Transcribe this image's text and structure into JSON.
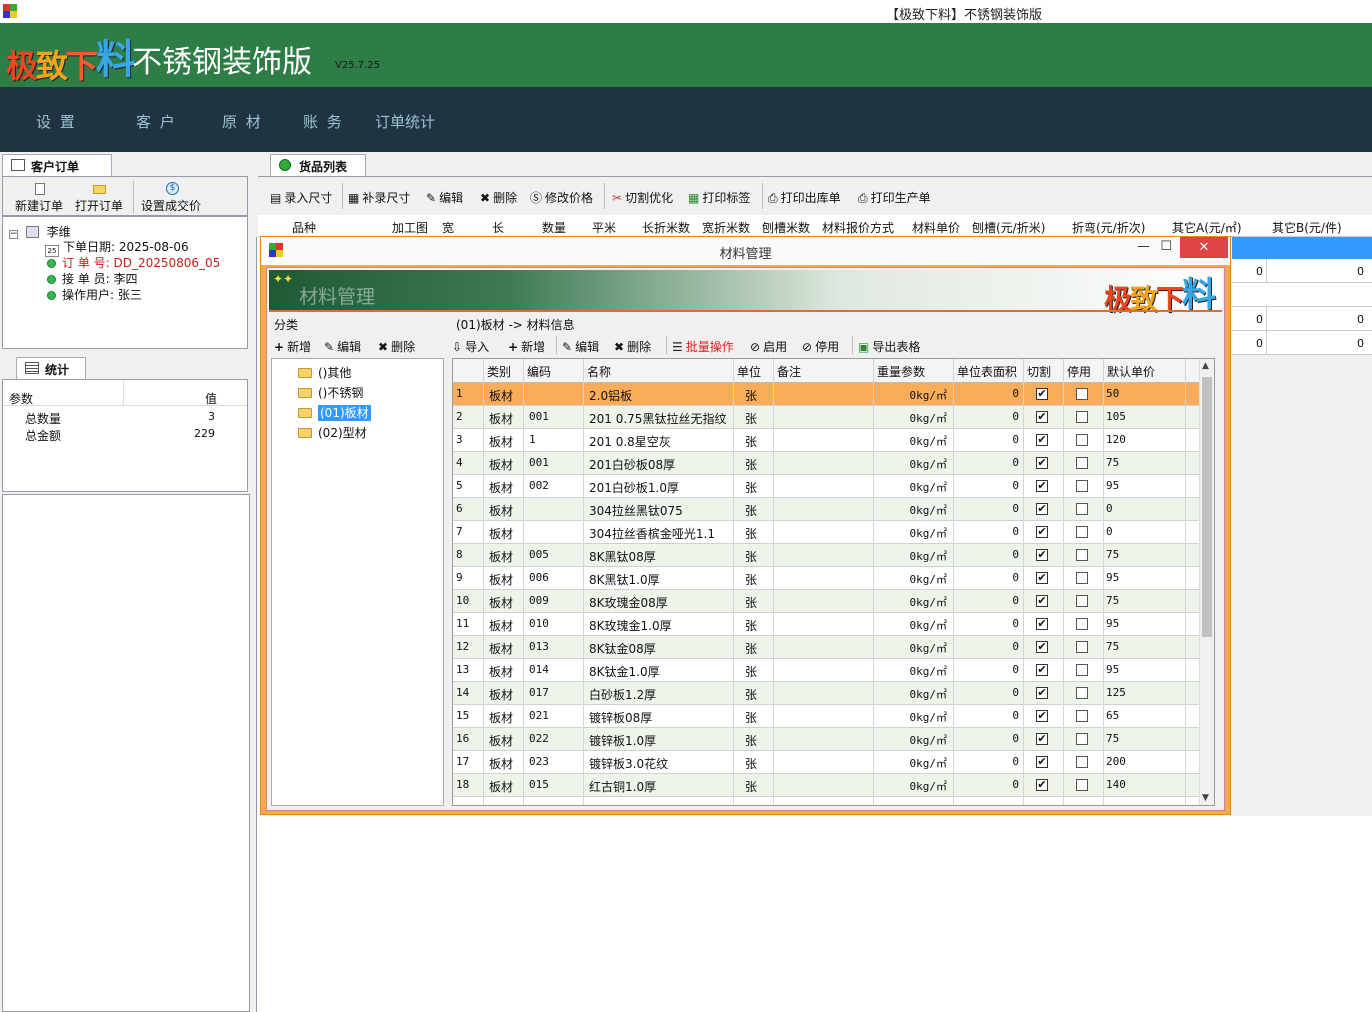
{
  "window": {
    "title": "【极致下料】不锈钢装饰版"
  },
  "banner": {
    "logo": [
      "极",
      "致",
      "下",
      "料"
    ],
    "product": "不锈钢装饰版",
    "version": "V25.7.25"
  },
  "menu": [
    "设 置",
    "客 户",
    "原 材",
    "账 务",
    "订单统计"
  ],
  "orders_panel": {
    "tab": "客户订单",
    "buttons": [
      "新建订单",
      "打开订单",
      "设置成交价"
    ],
    "tree": {
      "root": "李维",
      "date_label": "下单日期: 2025-08-06",
      "order_no_label": "订 单 号: ",
      "order_no": "DD_20250806_05",
      "receiver": "接 单 员: 李四",
      "operator": "操作用户: 张三",
      "calendar_day": "25"
    }
  },
  "stats_panel": {
    "tab": "统计",
    "headers": [
      "参数",
      "值"
    ],
    "rows": [
      {
        "k": "总数量",
        "v": "3"
      },
      {
        "k": "总金额",
        "v": "229"
      }
    ]
  },
  "goods_panel": {
    "tab": "货品列表",
    "toolbar": [
      "录入尺寸",
      "补录尺寸",
      "编辑",
      "删除",
      "修改价格",
      "切割优化",
      "打印标签",
      "打印出库单",
      "打印生产单"
    ],
    "columns": [
      "品种",
      "加工图",
      "宽",
      "长",
      "数量",
      "平米",
      "长折米数",
      "宽折米数",
      "刨槽米数",
      "材料报价方式",
      "材料单价",
      "刨槽(元/折米)",
      "折弯(元/折次)",
      "其它A(元/㎡)",
      "其它B(元/件)"
    ],
    "row_values": [
      [
        "0",
        "0"
      ],
      [
        "0",
        "0"
      ],
      [
        "0",
        "0"
      ]
    ]
  },
  "dialog": {
    "title": "材料管理",
    "controls": {
      "min": "—",
      "max": "☐",
      "close": "✕"
    },
    "watermark": "材料管理",
    "category": {
      "label": "分类",
      "buttons": [
        "新增",
        "编辑",
        "删除"
      ],
      "items": [
        "()其他",
        "()不锈钢",
        "(01)板材",
        "(02)型材"
      ]
    },
    "breadcrumb": "(01)板材 -> 材料信息",
    "toolbar": {
      "import": "导入",
      "add": "新增",
      "edit": "编辑",
      "delete": "删除",
      "batch": "批量操作",
      "enable": "启用",
      "disable": "停用",
      "export": "导出表格"
    },
    "columns": [
      "类别",
      "编码",
      "名称",
      "单位",
      "备注",
      "重量参数",
      "单位表面积",
      "切割",
      "停用",
      "默认单价"
    ],
    "rows": [
      {
        "n": "1",
        "cat": "板材",
        "code": "",
        "name": "2.0铝板",
        "unit": "张",
        "weight": "0kg/㎡",
        "area": "0",
        "price": "50"
      },
      {
        "n": "2",
        "cat": "板材",
        "code": "001",
        "name": "201 0.75黑钛拉丝无指纹",
        "unit": "张",
        "weight": "0kg/㎡",
        "area": "0",
        "price": "105"
      },
      {
        "n": "3",
        "cat": "板材",
        "code": "1",
        "name": "201 0.8星空灰",
        "unit": "张",
        "weight": "0kg/㎡",
        "area": "0",
        "price": "120"
      },
      {
        "n": "4",
        "cat": "板材",
        "code": "001",
        "name": "201白砂板08厚",
        "unit": "张",
        "weight": "0kg/㎡",
        "area": "0",
        "price": "75"
      },
      {
        "n": "5",
        "cat": "板材",
        "code": "002",
        "name": "201白砂板1.0厚",
        "unit": "张",
        "weight": "0kg/㎡",
        "area": "0",
        "price": "95"
      },
      {
        "n": "6",
        "cat": "板材",
        "code": "",
        "name": "304拉丝黑钛075",
        "unit": "张",
        "weight": "0kg/㎡",
        "area": "0",
        "price": "0"
      },
      {
        "n": "7",
        "cat": "板材",
        "code": "",
        "name": "304拉丝香槟金哑光1.1",
        "unit": "张",
        "weight": "0kg/㎡",
        "area": "0",
        "price": "0"
      },
      {
        "n": "8",
        "cat": "板材",
        "code": "005",
        "name": "8K黑钛08厚",
        "unit": "张",
        "weight": "0kg/㎡",
        "area": "0",
        "price": "75"
      },
      {
        "n": "9",
        "cat": "板材",
        "code": "006",
        "name": "8K黑钛1.0厚",
        "unit": "张",
        "weight": "0kg/㎡",
        "area": "0",
        "price": "95"
      },
      {
        "n": "10",
        "cat": "板材",
        "code": "009",
        "name": "8K玫瑰金08厚",
        "unit": "张",
        "weight": "0kg/㎡",
        "area": "0",
        "price": "75"
      },
      {
        "n": "11",
        "cat": "板材",
        "code": "010",
        "name": "8K玫瑰金1.0厚",
        "unit": "张",
        "weight": "0kg/㎡",
        "area": "0",
        "price": "95"
      },
      {
        "n": "12",
        "cat": "板材",
        "code": "013",
        "name": "8K钛金08厚",
        "unit": "张",
        "weight": "0kg/㎡",
        "area": "0",
        "price": "75"
      },
      {
        "n": "13",
        "cat": "板材",
        "code": "014",
        "name": "8K钛金1.0厚",
        "unit": "张",
        "weight": "0kg/㎡",
        "area": "0",
        "price": "95"
      },
      {
        "n": "14",
        "cat": "板材",
        "code": "017",
        "name": "白砂板1.2厚",
        "unit": "张",
        "weight": "0kg/㎡",
        "area": "0",
        "price": "125"
      },
      {
        "n": "15",
        "cat": "板材",
        "code": "021",
        "name": "镀锌板08厚",
        "unit": "张",
        "weight": "0kg/㎡",
        "area": "0",
        "price": "65"
      },
      {
        "n": "16",
        "cat": "板材",
        "code": "022",
        "name": "镀锌板1.0厚",
        "unit": "张",
        "weight": "0kg/㎡",
        "area": "0",
        "price": "75"
      },
      {
        "n": "17",
        "cat": "板材",
        "code": "023",
        "name": "镀锌板3.0花纹",
        "unit": "张",
        "weight": "0kg/㎡",
        "area": "0",
        "price": "200"
      },
      {
        "n": "18",
        "cat": "板材",
        "code": "015",
        "name": "红古铜1.0厚",
        "unit": "张",
        "weight": "0kg/㎡",
        "area": "0",
        "price": "140"
      }
    ]
  },
  "colors": {
    "banner": "#2e7d46",
    "menubar": "#1f3440",
    "dialog_border": "#f6a94a",
    "selected_row": "#f9ac5a",
    "close": "#e04343"
  }
}
